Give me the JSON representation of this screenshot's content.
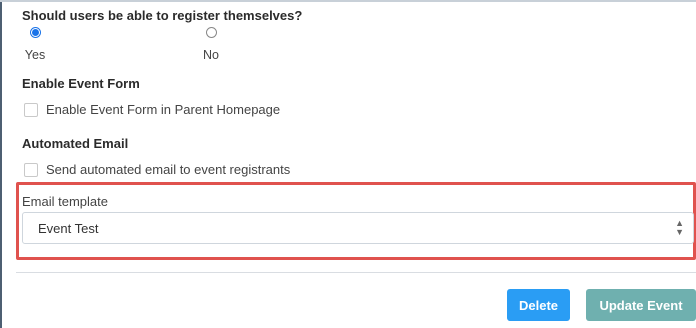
{
  "registration": {
    "question": "Should users be able to register themselves?",
    "options": [
      {
        "label": "Yes",
        "selected": true
      },
      {
        "label": "No",
        "selected": false
      }
    ]
  },
  "event_form": {
    "heading": "Enable Event Form",
    "checkbox_label": "Enable Event Form in Parent Homepage",
    "checked": false
  },
  "automated_email": {
    "heading": "Automated Email",
    "checkbox_label": "Send automated email to event registrants",
    "checked": false
  },
  "email_template": {
    "label": "Email template",
    "selected_value": "Event Test"
  },
  "actions": {
    "delete_label": "Delete",
    "update_label": "Update Event"
  },
  "colors": {
    "highlight": "#e0524e",
    "delete_button": "#2a9df4",
    "update_button": "#6fb0af",
    "radio_selected": "#1a73e8"
  }
}
